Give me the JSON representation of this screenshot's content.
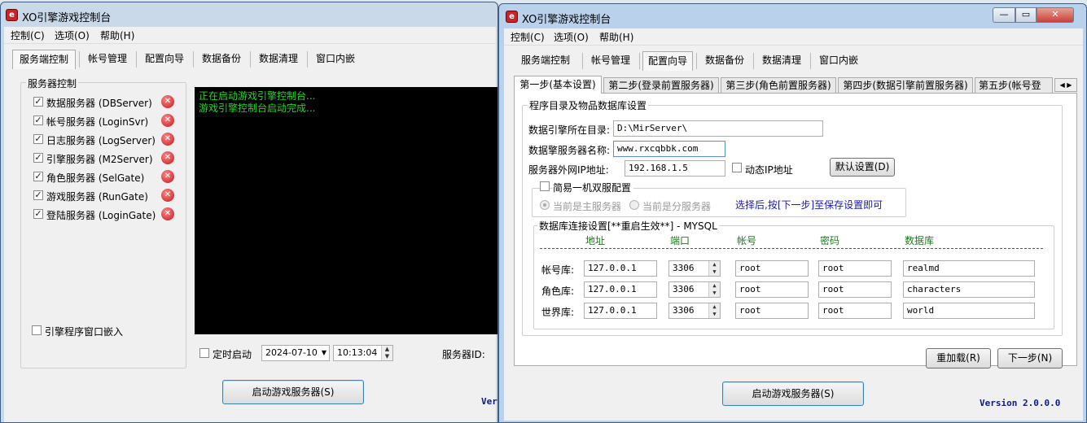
{
  "left": {
    "title": "XO引擎游戏控制台",
    "menu": [
      "控制(C)",
      "选项(O)",
      "帮助(H)"
    ],
    "tabs": [
      "服务端控制",
      "帐号管理",
      "配置向导",
      "数据备份",
      "数据清理",
      "窗口内嵌"
    ],
    "group_label": "服务器控制",
    "servers": [
      {
        "label": "数据服务器 (DBServer)"
      },
      {
        "label": "帐号服务器 (LoginSvr)"
      },
      {
        "label": "日志服务器 (LogServer)"
      },
      {
        "label": "引擎服务器 (M2Server)"
      },
      {
        "label": "角色服务器 (SelGate)"
      },
      {
        "label": "游戏服务器 (RunGate)"
      },
      {
        "label": "登陆服务器 (LoginGate)"
      }
    ],
    "embed_label": "引擎程序窗口嵌入",
    "console_lines": [
      "正在启动游戏引擎控制台...",
      "游戏引擎控制台启动完成..."
    ],
    "timer_label": "定时启动",
    "date": "2024-07-10",
    "time": "10:13:04",
    "server_id_label": "服务器ID:",
    "start_button": "启动游戏服务器(S)",
    "version_partial": "Ver"
  },
  "right": {
    "title": "XO引擎游戏控制台",
    "menu": [
      "控制(C)",
      "选项(O)",
      "帮助(H)"
    ],
    "tabs": [
      "服务端控制",
      "帐号管理",
      "配置向导",
      "数据备份",
      "数据清理",
      "窗口内嵌"
    ],
    "steps": [
      "第一步(基本设置)",
      "第二步(登录前置服务器)",
      "第三步(角色前置服务器)",
      "第四步(数据引擎前置服务器)",
      "第五步(帐号登"
    ],
    "group_title": "程序目录及物品数据库设置",
    "dir_label": "数据引擎所在目录:",
    "dir_value": "D:\\MirServer\\",
    "name_label": "数据擎服务器名称:",
    "name_value": "www.rxcqbbk.com",
    "ip_label": "服务器外网IP地址:",
    "ip_value": "192.168.1.5",
    "dynamic_ip": "动态IP地址",
    "default_btn": "默认设置(D)",
    "simple_label": "简易一机双服配置",
    "radio_master": "当前是主服务器",
    "radio_slave": "当前是分服务器",
    "hint": "选择后,按[下一步]至保存设置即可",
    "db_title": "数据库连接设置[**重启生效**] - MYSQL",
    "db_headers": [
      "地址",
      "端口",
      "帐号",
      "密码",
      "数据库"
    ],
    "db_rows": [
      {
        "label": "帐号库:",
        "addr": "127.0.0.1",
        "port": "3306",
        "user": "root",
        "pwd": "root",
        "db": "realmd"
      },
      {
        "label": "角色库:",
        "addr": "127.0.0.1",
        "port": "3306",
        "user": "root",
        "pwd": "root",
        "db": "characters"
      },
      {
        "label": "世界库:",
        "addr": "127.0.0.1",
        "port": "3306",
        "user": "root",
        "pwd": "root",
        "db": "world"
      }
    ],
    "reload_btn": "重加载(R)",
    "next_btn": "下一步(N)",
    "start_button": "启动游戏服务器(S)",
    "version": "Version 2.0.0.0"
  },
  "colors": {
    "console_text": "#2bd12b",
    "accent_blue": "#1a1ab0",
    "db_header": "#1f7a1f",
    "close": "#c8403a"
  }
}
